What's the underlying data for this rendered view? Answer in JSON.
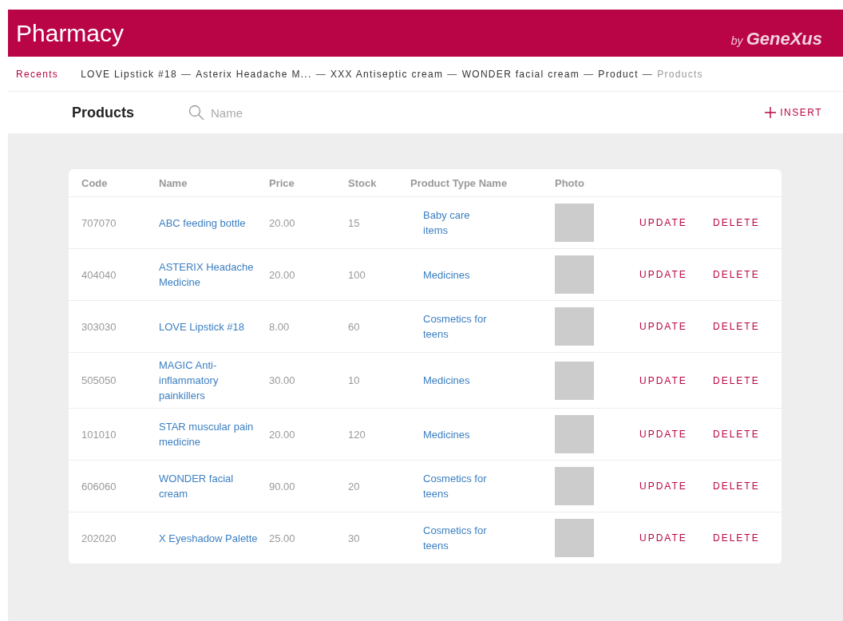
{
  "header": {
    "title": "Pharmacy",
    "brand_by": "by",
    "brand": "GeneXus"
  },
  "recents": {
    "label": "Recents",
    "items": [
      {
        "text": "LOVE Lipstick #18",
        "current": false
      },
      {
        "text": "Asterix Headache M...",
        "current": false
      },
      {
        "text": "XXX Antiseptic cream",
        "current": false
      },
      {
        "text": "WONDER facial cream",
        "current": false
      },
      {
        "text": "Product",
        "current": false
      },
      {
        "text": "Products",
        "current": true
      }
    ],
    "separator": "—"
  },
  "toolbar": {
    "title": "Products",
    "search": {
      "placeholder": "Name"
    },
    "insert": "INSERT"
  },
  "table": {
    "columns": [
      "Code",
      "Name",
      "Price",
      "Stock",
      "Product Type Name",
      "Photo"
    ],
    "rows": [
      {
        "code": "707070",
        "name": "ABC feeding bottle",
        "price": "20.00",
        "stock": "15",
        "type": "Baby care items",
        "update": "UPDATE",
        "delete": "DELETE"
      },
      {
        "code": "404040",
        "name": "ASTERIX Headache Medicine",
        "price": "20.00",
        "stock": "100",
        "type": "Medicines",
        "update": "UPDATE",
        "delete": "DELETE"
      },
      {
        "code": "303030",
        "name": "LOVE Lipstick #18",
        "price": "8.00",
        "stock": "60",
        "type": "Cosmetics for teens",
        "update": "UPDATE",
        "delete": "DELETE"
      },
      {
        "code": "505050",
        "name": "MAGIC Anti-inflammatory painkillers",
        "price": "30.00",
        "stock": "10",
        "type": "Medicines",
        "update": "UPDATE",
        "delete": "DELETE"
      },
      {
        "code": "101010",
        "name": "STAR muscular pain medicine",
        "price": "20.00",
        "stock": "120",
        "type": "Medicines",
        "update": "UPDATE",
        "delete": "DELETE"
      },
      {
        "code": "606060",
        "name": "WONDER facial cream",
        "price": "90.00",
        "stock": "20",
        "type": "Cosmetics for teens",
        "update": "UPDATE",
        "delete": "DELETE"
      },
      {
        "code": "202020",
        "name": "X Eyeshadow Palette",
        "price": "25.00",
        "stock": "30",
        "type": "Cosmetics for teens",
        "update": "UPDATE",
        "delete": "DELETE"
      }
    ]
  }
}
